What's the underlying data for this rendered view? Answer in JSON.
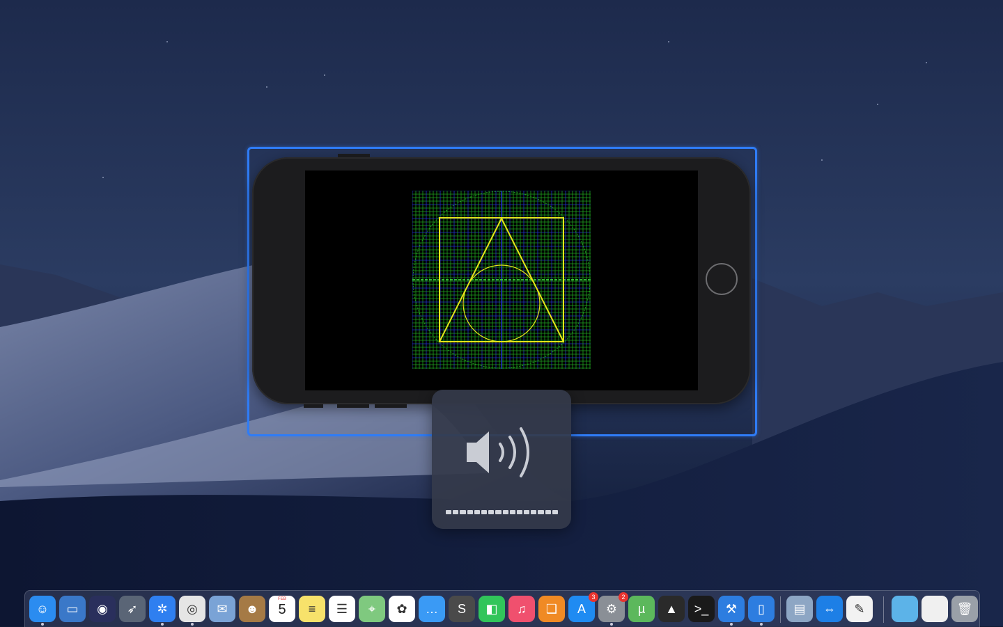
{
  "desktop": {
    "wallpaper": "macOS Mojave dark dunes"
  },
  "simulator": {
    "device": "iPhone landscape",
    "screen_background": "#000000",
    "selection_color": "#2f7cf6",
    "graphic": {
      "grid_minor": "#1fa31f",
      "grid_major": "#2233cc",
      "shapes": "#e5e51a",
      "axis": "#44ee44"
    }
  },
  "volume_hud": {
    "icon": "speaker-volume-icon",
    "level_fraction": 1.0,
    "segments": 16,
    "filled_segments": 16
  },
  "dock": {
    "items": [
      {
        "name": "finder",
        "icon": "finder-icon",
        "color": "#2b8cf0",
        "glyph": "☺",
        "running": true
      },
      {
        "name": "file-manager",
        "icon": "folder-window-icon",
        "color": "#3a78c8",
        "glyph": "▭",
        "running": false
      },
      {
        "name": "siri",
        "icon": "siri-icon",
        "color": "#2a2f5c",
        "glyph": "◉",
        "running": false
      },
      {
        "name": "launchpad",
        "icon": "rocket-icon",
        "color": "#5a6576",
        "glyph": "➶",
        "running": false
      },
      {
        "name": "safari",
        "icon": "compass-icon",
        "color": "#2f7ff0",
        "glyph": "✲",
        "running": true
      },
      {
        "name": "chrome",
        "icon": "chrome-icon",
        "color": "#e5e5e5",
        "glyph": "◎",
        "running": true
      },
      {
        "name": "mail",
        "icon": "mail-eagle-icon",
        "color": "#7aa3d6",
        "glyph": "✉",
        "running": false
      },
      {
        "name": "contacts",
        "icon": "contacts-book-icon",
        "color": "#a57a45",
        "glyph": "☻",
        "running": false
      },
      {
        "name": "calendar",
        "icon": "calendar-icon",
        "color": "#ffffff",
        "glyph": "",
        "running": false,
        "month": "FEB",
        "day": "5"
      },
      {
        "name": "notes",
        "icon": "notes-icon",
        "color": "#f7e26b",
        "glyph": "≡",
        "running": false
      },
      {
        "name": "reminders",
        "icon": "reminders-icon",
        "color": "#ffffff",
        "glyph": "☰",
        "running": false
      },
      {
        "name": "maps",
        "icon": "maps-icon",
        "color": "#7fc97f",
        "glyph": "⌖",
        "running": false
      },
      {
        "name": "photos",
        "icon": "photos-flower-icon",
        "color": "#ffffff",
        "glyph": "✿",
        "running": false
      },
      {
        "name": "messages",
        "icon": "message-bubble-icon",
        "color": "#3a9af5",
        "glyph": "…",
        "running": false
      },
      {
        "name": "sublime-text",
        "icon": "sublime-icon",
        "color": "#4a4a4a",
        "glyph": "S",
        "running": false
      },
      {
        "name": "facetime",
        "icon": "facetime-icon",
        "color": "#31c55a",
        "glyph": "◧",
        "running": false
      },
      {
        "name": "music",
        "icon": "music-note-icon",
        "color": "#f0506e",
        "glyph": "♫",
        "running": false
      },
      {
        "name": "books",
        "icon": "books-icon",
        "color": "#f08a24",
        "glyph": "❑",
        "running": false
      },
      {
        "name": "app-store",
        "icon": "app-store-icon",
        "color": "#1f8bf2",
        "glyph": "A",
        "running": false,
        "badge": "3"
      },
      {
        "name": "system-preferences",
        "icon": "gear-icon",
        "color": "#8a8f96",
        "glyph": "⚙",
        "running": true,
        "badge": "2"
      },
      {
        "name": "utorrent",
        "icon": "utorrent-icon",
        "color": "#5cb85c",
        "glyph": "µ",
        "running": false
      },
      {
        "name": "vlc",
        "icon": "cone-icon",
        "color": "#2a2a2a",
        "glyph": "▲",
        "running": false
      },
      {
        "name": "terminal",
        "icon": "terminal-icon",
        "color": "#1a1a1a",
        "glyph": ">_",
        "running": false
      },
      {
        "name": "xcode",
        "icon": "hammer-blueprint-icon",
        "color": "#2d7de0",
        "glyph": "⚒",
        "running": true
      },
      {
        "name": "simulator",
        "icon": "simulator-icon",
        "color": "#2d7de0",
        "glyph": "▯",
        "running": true
      },
      {
        "name": "preview",
        "icon": "preview-icon",
        "color": "#8da6c4",
        "glyph": "▤",
        "running": false
      },
      {
        "name": "teamviewer",
        "icon": "teamviewer-icon",
        "color": "#1d7fe6",
        "glyph": "⇔",
        "running": false
      },
      {
        "name": "textedit",
        "icon": "textedit-icon",
        "color": "#f2f2f2",
        "glyph": "✎",
        "running": false
      },
      {
        "name": "folder",
        "icon": "folder-icon",
        "color": "#5cb3e8",
        "glyph": "",
        "running": false
      },
      {
        "name": "chrome-window",
        "icon": "chrome-window-icon",
        "color": "#f0f0f0",
        "glyph": "",
        "running": false
      },
      {
        "name": "trash",
        "icon": "trash-icon",
        "color": "#9aa0a8",
        "glyph": "🗑",
        "running": false
      }
    ]
  }
}
